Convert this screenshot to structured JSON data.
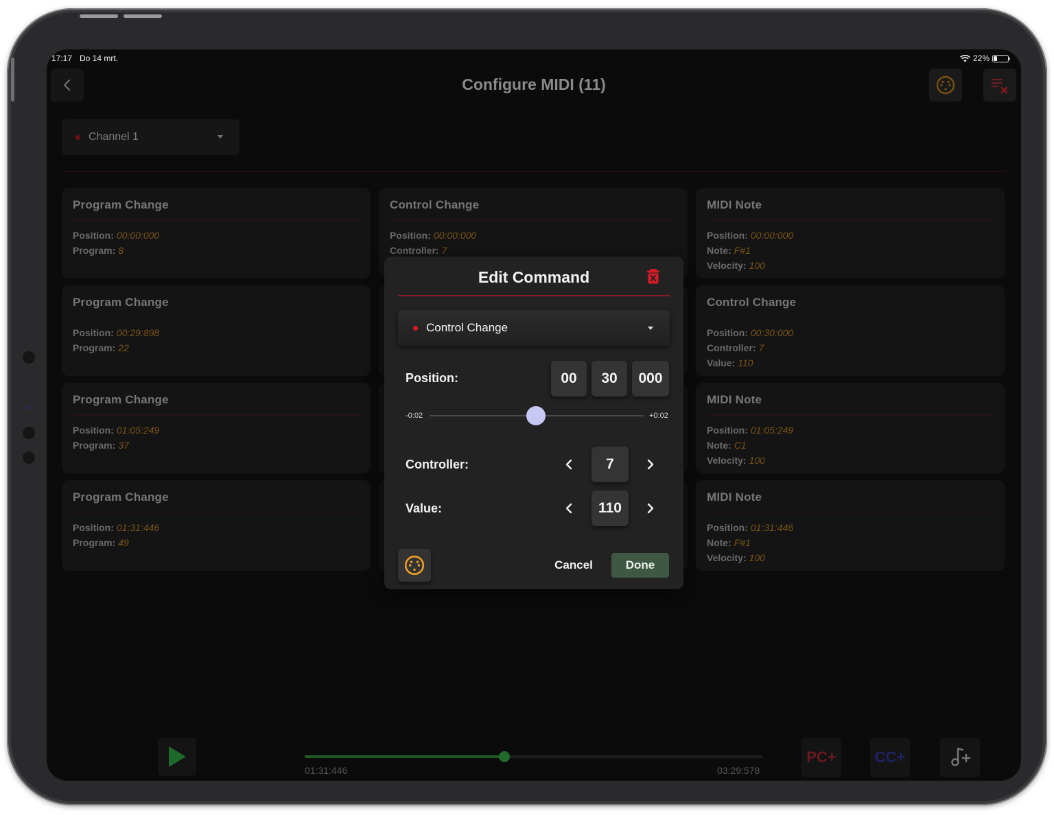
{
  "status_bar": {
    "time": "17:17",
    "date": "Do 14 mrt.",
    "battery": "22%"
  },
  "header": {
    "title": "Configure MIDI (11)"
  },
  "channel_select": {
    "value": "Channel 1"
  },
  "cards": [
    {
      "title": "Program Change",
      "rows": [
        {
          "label": "Position:",
          "value": "00:00:000"
        },
        {
          "label": "Program:",
          "value": "8"
        }
      ]
    },
    {
      "title": "Control Change",
      "rows": [
        {
          "label": "Position:",
          "value": "00:00:000"
        },
        {
          "label": "Controller:",
          "value": "7"
        }
      ]
    },
    {
      "title": "MIDI Note",
      "rows": [
        {
          "label": "Position:",
          "value": "00:00:000"
        },
        {
          "label": "Note:",
          "value": "F#1"
        },
        {
          "label": "Velocity:",
          "value": "100"
        }
      ]
    },
    {
      "title": "Program Change",
      "rows": [
        {
          "label": "Position:",
          "value": "00:29:898"
        },
        {
          "label": "Program:",
          "value": "22"
        }
      ]
    },
    {
      "title": "Control Change",
      "rows": [
        {
          "label": "Position:",
          "value": "00:30:000"
        },
        {
          "label": "Controller:",
          "value": "7"
        },
        {
          "label": "Value:",
          "value": "110"
        }
      ]
    },
    {
      "title": "Program Change",
      "rows": [
        {
          "label": "Position:",
          "value": "01:05:249"
        },
        {
          "label": "Program:",
          "value": "37"
        }
      ]
    },
    {
      "title": "MIDI Note",
      "rows": [
        {
          "label": "Position:",
          "value": "01:05:249"
        },
        {
          "label": "Note:",
          "value": "C1"
        },
        {
          "label": "Velocity:",
          "value": "100"
        }
      ]
    },
    {
      "title": "Program Change",
      "rows": [
        {
          "label": "Position:",
          "value": "01:31:446"
        },
        {
          "label": "Program:",
          "value": "49"
        }
      ]
    },
    {
      "title": "MIDI Note",
      "rows": [
        {
          "label": "Position:",
          "value": "01:31:446"
        },
        {
          "label": "Note:",
          "value": "F#1"
        },
        {
          "label": "Velocity:",
          "value": "100"
        }
      ]
    }
  ],
  "transport": {
    "current_time": "01:31:446",
    "total_time": "03:29:578",
    "progress": 0.436,
    "pc_add_label": "PC+",
    "cc_add_label": "CC+"
  },
  "modal": {
    "title": "Edit Command",
    "type_select": "Control Change",
    "position_label": "Position:",
    "position": {
      "minutes": "00",
      "seconds": "30",
      "millis": "000"
    },
    "slider": {
      "min_label": "-0:02",
      "max_label": "+0:02",
      "value": 0
    },
    "controller_label": "Controller:",
    "controller_value": "7",
    "value_label": "Value:",
    "value_value": "110",
    "cancel_label": "Cancel",
    "done_label": "Done"
  },
  "colors": {
    "accent_red": "#d41c26",
    "value_orange": "#7a5517",
    "done_green": "#3e5843",
    "slider_thumb": "#c8c8f4",
    "din_orange": "#f0a020"
  },
  "icons": [
    "chevron-left-icon",
    "midi-din-icon",
    "clear-list-icon",
    "trash-icon",
    "play-icon",
    "chevron-right-icon",
    "add-note-icon"
  ]
}
